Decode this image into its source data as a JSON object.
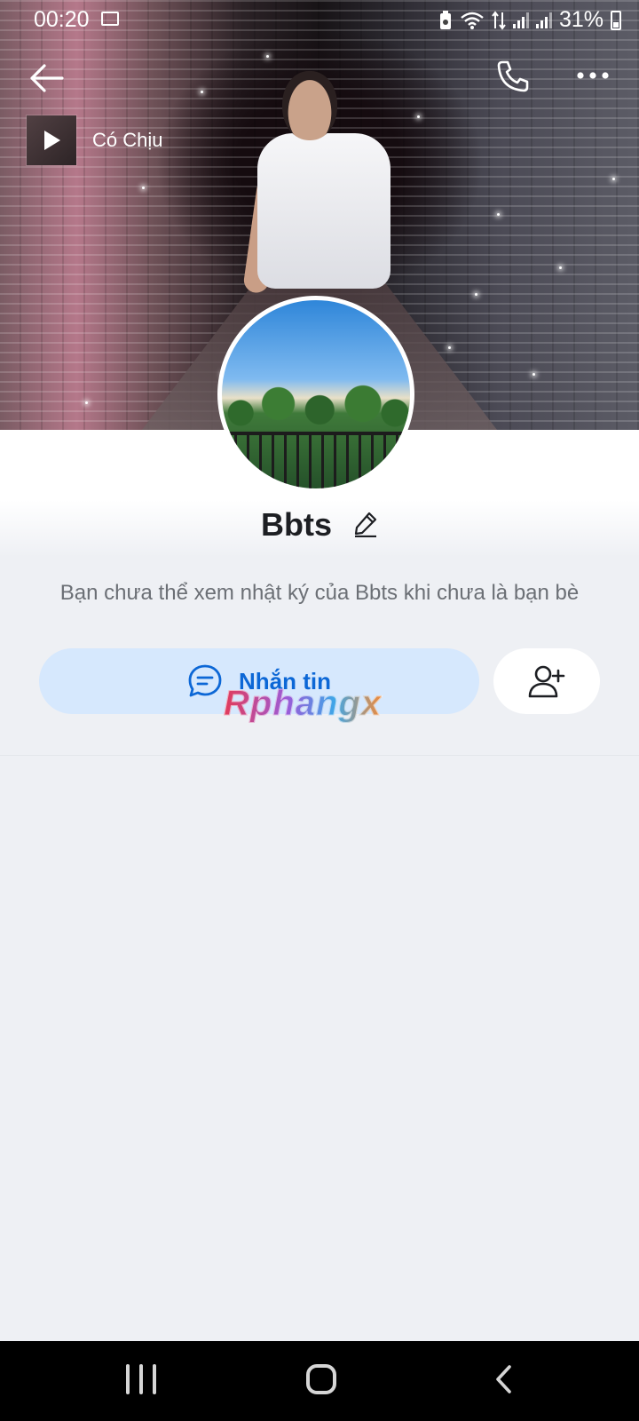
{
  "status_bar": {
    "time": "00:20",
    "battery": "31%",
    "icons": [
      "image-icon",
      "battery-saver-icon",
      "wifi-icon",
      "data-arrows-icon",
      "signal-icon",
      "signal-icon",
      "battery-icon"
    ]
  },
  "header": {
    "back_icon": "back-arrow-icon",
    "call_icon": "phone-icon",
    "more_icon": "more-dots-icon"
  },
  "music": {
    "title": "Có Chịu",
    "icon": "play-icon"
  },
  "profile": {
    "name": "Bbts",
    "edit_icon": "pencil-icon",
    "info_text": "Bạn chưa thể xem nhật ký của Bbts khi chưa là bạn bè"
  },
  "actions": {
    "message_label": "Nhắn tin",
    "message_icon": "chat-bubble-icon",
    "add_friend_icon": "add-user-icon"
  },
  "watermark": "Rphangx",
  "colors": {
    "accent": "#0c67d6",
    "message_button_bg": "#d6e8fd",
    "background": "#eef0f4"
  },
  "nav_bar": {
    "icons": [
      "recents-icon",
      "home-icon",
      "back-icon"
    ]
  }
}
